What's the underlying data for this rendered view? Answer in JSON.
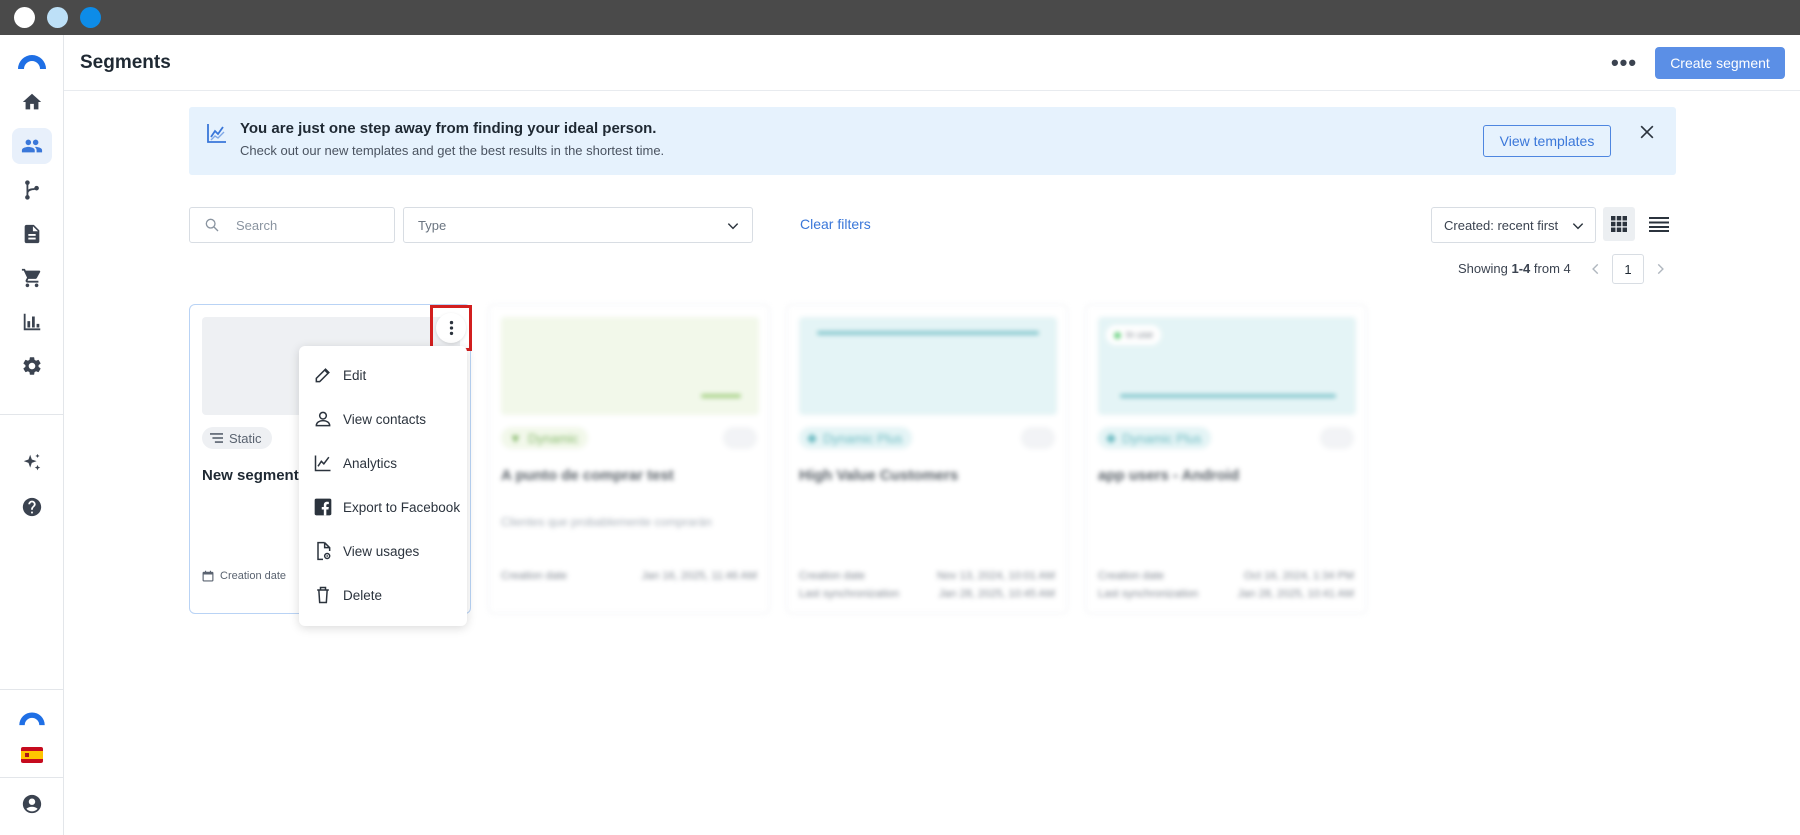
{
  "window": {
    "dot_colors": [
      "#ffffff",
      "#bde0f7",
      "#0d8ce8"
    ]
  },
  "header": {
    "title": "Segments",
    "more_label": "•••",
    "create_label": "Create segment"
  },
  "sidebar": {
    "items": [
      {
        "icon": "home-icon"
      },
      {
        "icon": "users-icon",
        "active": true
      },
      {
        "icon": "flow-icon"
      },
      {
        "icon": "document-icon"
      },
      {
        "icon": "cart-icon"
      },
      {
        "icon": "chart-icon"
      },
      {
        "icon": "gear-icon"
      },
      {
        "icon": "sparkles-icon"
      },
      {
        "icon": "help-icon"
      }
    ],
    "bottom": [
      {
        "icon": "brand-logo"
      },
      {
        "icon": "spain-flag-icon"
      },
      {
        "icon": "account-icon"
      }
    ]
  },
  "banner": {
    "title": "You are just one step away from finding your ideal person.",
    "subtitle": "Check out our new templates and get the best results in the shortest time.",
    "button": "View templates"
  },
  "filters": {
    "search_placeholder": "Search",
    "type_placeholder": "Type",
    "clear": "Clear filters",
    "sort": "Created: recent first"
  },
  "pagination": {
    "prefix": "Showing ",
    "range": "1-4",
    "suffix": " from 4",
    "page": "1"
  },
  "cards": [
    {
      "badge": "Static",
      "name": "New segment",
      "meta1": "Creation date"
    },
    {
      "badge": "Dynamic",
      "name": "A punto de comprar test",
      "desc": "Clientes que probablemente comprarán",
      "meta1": "Creation date",
      "date1": "Jan 16, 2025, 11:46 AM"
    },
    {
      "badge": "Dynamic Plus",
      "name": "High Value Customers",
      "meta1": "Creation date",
      "date1": "Nov 13, 2024, 10:01 AM",
      "meta2": "Last synchronization",
      "date2": "Jan 28, 2025, 10:45 AM"
    },
    {
      "badge": "Dynamic Plus",
      "name": "app users - Android",
      "meta1": "Creation date",
      "date1": "Oct 16, 2024, 1:34 PM",
      "meta2": "Last synchronization",
      "date2": "Jan 28, 2025, 10:41 AM",
      "tag": "In use"
    }
  ],
  "context_menu": {
    "items": [
      {
        "label": "Edit",
        "icon": "pencil-icon"
      },
      {
        "label": "View contacts",
        "icon": "person-icon"
      },
      {
        "label": "Analytics",
        "icon": "analytics-icon"
      },
      {
        "label": "Export to Facebook",
        "icon": "facebook-icon"
      },
      {
        "label": "View usages",
        "icon": "file-view-icon"
      },
      {
        "label": "Delete",
        "icon": "trash-icon"
      }
    ]
  },
  "colors": {
    "accent": "#3a77d9",
    "primary_button": "#5b8fe6",
    "banner_bg": "#e6f2fd",
    "highlight": "#d21f1f"
  }
}
